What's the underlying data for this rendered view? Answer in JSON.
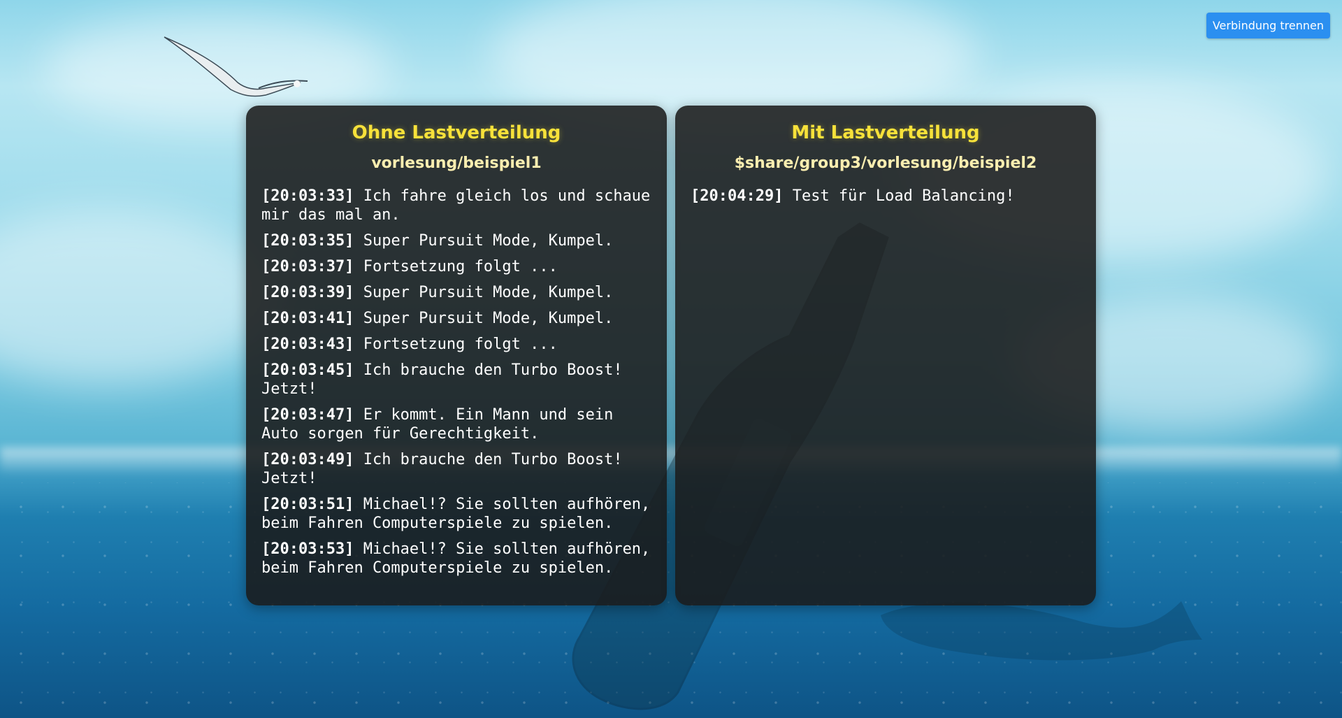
{
  "header": {
    "disconnect_label": "Verbindung trennen"
  },
  "colors": {
    "accent": "#2b8ff0",
    "title": "#f7e13a",
    "topic": "#fbeeb0",
    "panel_bg": "#1a1a1a"
  },
  "background": {
    "icons": [
      "seagull-icon",
      "bottle-icon",
      "whale-icon"
    ]
  },
  "panels": [
    {
      "title": "Ohne Lastverteilung",
      "topic": "vorlesung/beispiel1",
      "messages": [
        {
          "time": "[20:03:33]",
          "text": "Ich fahre gleich los und schaue mir das mal an."
        },
        {
          "time": "[20:03:35]",
          "text": "Super Pursuit Mode, Kumpel."
        },
        {
          "time": "[20:03:37]",
          "text": "Fortsetzung folgt ..."
        },
        {
          "time": "[20:03:39]",
          "text": "Super Pursuit Mode, Kumpel."
        },
        {
          "time": "[20:03:41]",
          "text": "Super Pursuit Mode, Kumpel."
        },
        {
          "time": "[20:03:43]",
          "text": "Fortsetzung folgt ..."
        },
        {
          "time": "[20:03:45]",
          "text": "Ich brauche den Turbo Boost! Jetzt!"
        },
        {
          "time": "[20:03:47]",
          "text": "Er kommt. Ein Mann und sein Auto sorgen für Gerechtigkeit."
        },
        {
          "time": "[20:03:49]",
          "text": "Ich brauche den Turbo Boost! Jetzt!"
        },
        {
          "time": "[20:03:51]",
          "text": "Michael!? Sie sollten aufhören, beim Fahren Computerspiele zu spielen."
        },
        {
          "time": "[20:03:53]",
          "text": "Michael!? Sie sollten aufhören, beim Fahren Computerspiele zu spielen."
        }
      ]
    },
    {
      "title": "Mit Lastverteilung",
      "topic": "$share/group3/vorlesung/beispiel2",
      "messages": [
        {
          "time": "[20:04:29]",
          "text": "Test für Load Balancing!"
        }
      ]
    }
  ]
}
